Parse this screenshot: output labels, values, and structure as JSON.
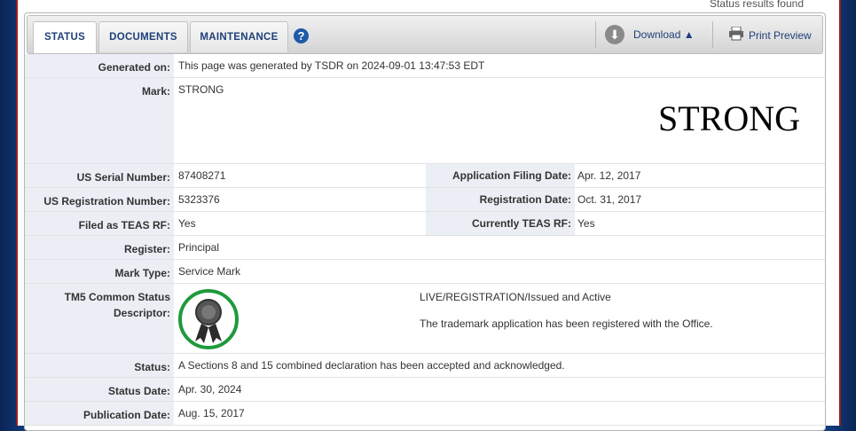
{
  "header": {
    "results_found": "Status results found"
  },
  "tabs": [
    {
      "label": "STATUS",
      "active": true
    },
    {
      "label": "DOCUMENTS",
      "active": false
    },
    {
      "label": "MAINTENANCE",
      "active": false
    }
  ],
  "help_icon": "?",
  "download": {
    "label": "Download",
    "icon": "download-arrow-icon"
  },
  "print_preview": {
    "label": "Print Preview",
    "icon": "printer-icon"
  },
  "fields": {
    "generated_on": {
      "label": "Generated on:",
      "value": "This page was generated by TSDR on 2024-09-01 13:47:53 EDT"
    },
    "mark": {
      "label": "Mark:",
      "value": "STRONG",
      "image_text": "STRONG"
    },
    "serial_number": {
      "label": "US Serial Number:",
      "value": "87408271"
    },
    "filing_date": {
      "label": "Application Filing Date:",
      "value": "Apr. 12, 2017"
    },
    "registration_number": {
      "label": "US Registration Number:",
      "value": "5323376"
    },
    "registration_date": {
      "label": "Registration Date:",
      "value": "Oct. 31, 2017"
    },
    "filed_teas_rf": {
      "label": "Filed as TEAS RF:",
      "value": "Yes"
    },
    "currently_teas_rf": {
      "label": "Currently TEAS RF:",
      "value": "Yes"
    },
    "register": {
      "label": "Register:",
      "value": "Principal"
    },
    "mark_type": {
      "label": "Mark Type:",
      "value": "Service Mark"
    },
    "tm5": {
      "label_line1": "TM5 Common Status",
      "label_line2": "Descriptor:",
      "status": "LIVE/REGISTRATION/Issued and Active",
      "description": "The trademark application has been registered with the Office.",
      "badge_color": "#1e9a3c"
    },
    "status": {
      "label": "Status:",
      "value": "A Sections 8 and 15 combined declaration has been accepted and acknowledged."
    },
    "status_date": {
      "label": "Status Date:",
      "value": "Apr. 30, 2024"
    },
    "publication_date": {
      "label": "Publication Date:",
      "value": "Aug. 15, 2017"
    }
  }
}
